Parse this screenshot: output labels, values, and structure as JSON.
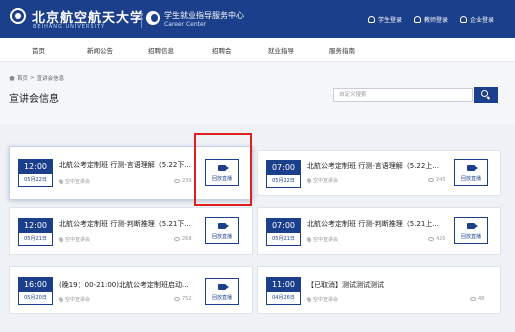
{
  "header": {
    "university_cn": "北京航空航天大学",
    "university_en": "BEIHANG UNIVERSITY",
    "center_cn": "学生就业指导服务中心",
    "center_en": "Career Center",
    "logins": [
      "学生登录",
      "教师登录",
      "企业登录"
    ],
    "brand_color": "#1b3f8b"
  },
  "nav": [
    "首页",
    "新闻公告",
    "招聘信息",
    "招聘会",
    "就业指导",
    "服务指南"
  ],
  "breadcrumb": {
    "home": "首页",
    "sep": ">",
    "current": "宣讲会信息"
  },
  "page_title": "宣讲会信息",
  "search": {
    "placeholder": "自定义搜索"
  },
  "replay_label": "回放直播",
  "cards": [
    {
      "time": "12:00",
      "date": "05月22日",
      "title": "北航公考定制班 行测-言语理解（5.22下...",
      "location": "空中宣讲会",
      "views": "239",
      "replay": true
    },
    {
      "time": "07:00",
      "date": "05月22日",
      "title": "北航公考定制班 行测-言语理解（5.22上...",
      "location": "空中宣讲会",
      "views": "245",
      "replay": true
    },
    {
      "time": "12:00",
      "date": "05月21日",
      "title": "北航公考定制班 行测-判断推理（5.21下...",
      "location": "空中宣讲会",
      "views": "268",
      "replay": true
    },
    {
      "time": "07:00",
      "date": "05月21日",
      "title": "北航公考定制班 行测-判断推理（5.21上...",
      "location": "空中宣讲会",
      "views": "420",
      "replay": true
    },
    {
      "time": "16:00",
      "date": "05月20日",
      "title": "(晚19：00-21:00)北航公考定制班启动...",
      "location": "空中宣讲会",
      "views": "752",
      "replay": true
    },
    {
      "time": "11:00",
      "date": "04月26日",
      "title": "【已取消】测试测试测试",
      "location": "空中宣讲会",
      "views": "48",
      "replay": false
    }
  ]
}
